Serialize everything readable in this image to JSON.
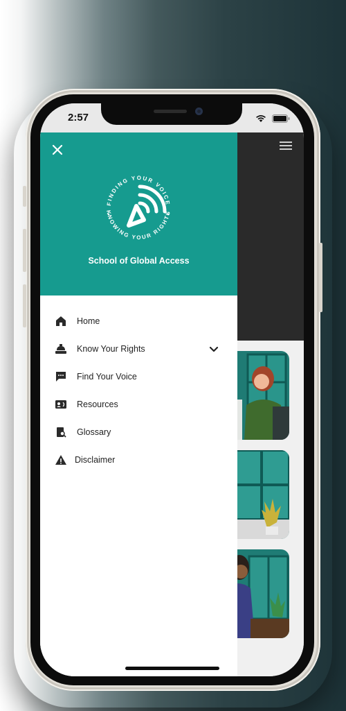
{
  "status_bar": {
    "time": "2:57",
    "icons": [
      "wifi-icon",
      "battery-icon"
    ]
  },
  "header": {
    "menu_icon": "hamburger-icon"
  },
  "drawer": {
    "close_icon": "close-icon",
    "logo": {
      "top_text": "FINDING YOUR VOICE",
      "bottom_text": "KNOWING YOUR RIGHTS"
    },
    "org_name": "School of Global Access",
    "menu_items": [
      {
        "label": "Home",
        "icon": "home-icon"
      },
      {
        "label": "Know Your Rights",
        "icon": "gavel-icon",
        "expandable": true
      },
      {
        "label": "Find Your Voice",
        "icon": "speech-bubble-icon"
      },
      {
        "label": "Resources",
        "icon": "contact-card-icon"
      },
      {
        "label": "Glossary",
        "icon": "book-search-icon"
      },
      {
        "label": "Disclaimer",
        "icon": "warning-icon"
      }
    ]
  },
  "colors": {
    "drawer_header": "#169b8f",
    "accent_teal": "#169b8f",
    "dark_header": "#2a2a2a"
  }
}
